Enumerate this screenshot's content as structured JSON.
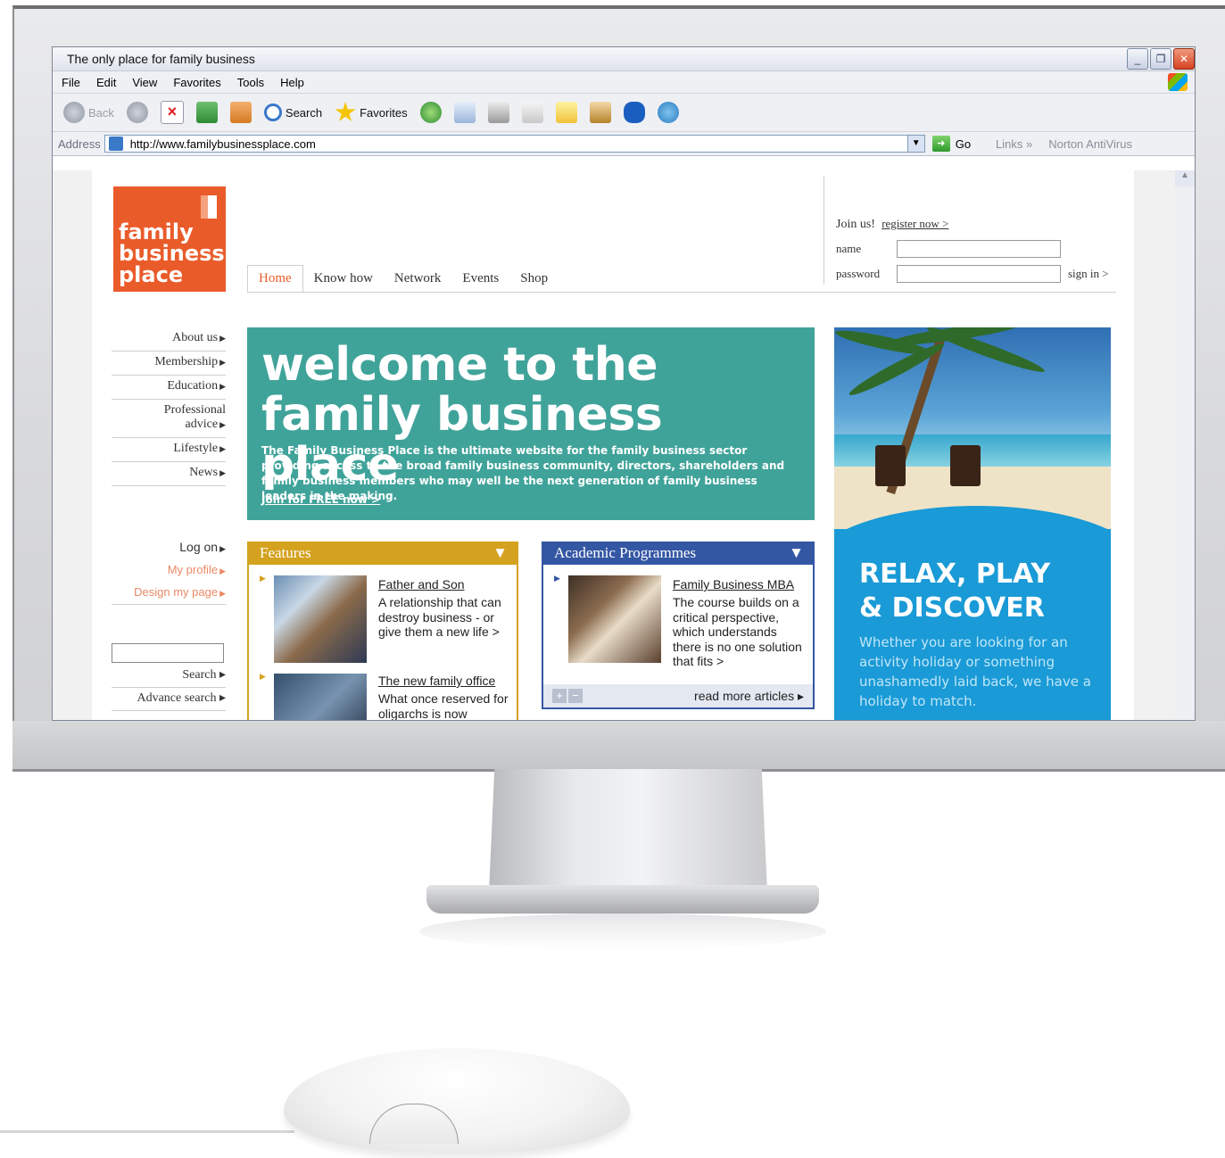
{
  "window": {
    "title": "The only place for family business",
    "controls": [
      "_",
      "❐",
      "✕"
    ]
  },
  "menu": [
    "File",
    "Edit",
    "View",
    "Favorites",
    "Tools",
    "Help"
  ],
  "toolbar": {
    "back": "Back",
    "search": "Search",
    "favorites": "Favorites",
    "icons": [
      "back-icon",
      "forward-icon",
      "stop-icon",
      "refresh-icon",
      "home-icon",
      "search-icon",
      "favorites-star-icon",
      "history-icon",
      "mail-icon",
      "print-icon",
      "edit-icon",
      "notes-icon",
      "messenger-icon",
      "bluetooth-icon",
      "contacts-icon"
    ]
  },
  "address": {
    "label": "Address",
    "url": "http://www.familybusinessplace.com",
    "go": "Go",
    "links": "Links",
    "links_chevron": "»",
    "norton": "Norton AntiVirus"
  },
  "site": {
    "logo": [
      "family",
      "business",
      "place"
    ],
    "nav": [
      "Home",
      "Know how",
      "Network",
      "Events",
      "Shop"
    ],
    "login": {
      "join": "Join us!",
      "register": "register now >",
      "name_label": "name",
      "password_label": "password",
      "signin": "sign in >"
    },
    "sidemenu": [
      "About us",
      "Membership",
      "Education",
      "Professional",
      "advice",
      "Lifestyle",
      "News"
    ],
    "account": {
      "logon": "Log on",
      "profile": "My profile",
      "design": "Design my page"
    },
    "search": {
      "button": "Search ▸",
      "advanced": "Advance search ▸"
    },
    "hero": {
      "title_line1": "welcome to the",
      "title_line2": "family business place",
      "text": "The Family Business Place is the ultimate website for the family business sector providing access to the broad family business community, directors, shareholders and family business members who may well be the next generation of family business leaders in the making.",
      "join": "Join for FREE now >"
    },
    "features": {
      "title": "Features",
      "articles": [
        {
          "title": "Father and Son",
          "text": "A relationship that can destroy business - or give them a new life >"
        },
        {
          "title": "The new family office",
          "text": "What once reserved for oligarchs is now"
        }
      ]
    },
    "academic": {
      "title": "Academic Programmes",
      "article": {
        "title": "Family Business MBA",
        "text": "The course builds on a critical perspective, which understands there is no one solution that fits >"
      },
      "more": "read more articles ▸"
    },
    "ad": {
      "title_line1": "RELAX, PLAY",
      "title_line2": "& DISCOVER",
      "text": "Whether you are looking for an activity holiday or something unashamedly laid back, we have a holiday to match."
    },
    "colors": {
      "brand_orange": "#ea5b2a",
      "teal": "#40a39a",
      "features_gold": "#d4a21e",
      "academic_blue": "#3457a4",
      "ad_blue": "#1a9ad6"
    }
  }
}
